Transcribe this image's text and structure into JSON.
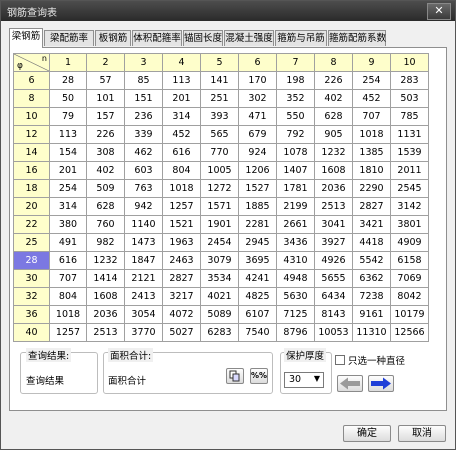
{
  "window": {
    "title": "钢筋查询表",
    "close_label": "✕"
  },
  "tabs": [
    "梁钢筋",
    "梁配筋率",
    "板钢筋",
    "体积配箍率",
    "锚固长度",
    "混凝土强度",
    "箍筋与吊筋",
    "箍筋配筋系数"
  ],
  "active_tab": 0,
  "table": {
    "corner": {
      "n": "n",
      "phi": "φ"
    },
    "columns": [
      "1",
      "2",
      "3",
      "4",
      "5",
      "6",
      "7",
      "8",
      "9",
      "10"
    ],
    "rows": [
      {
        "d": "6",
        "v": [
          "28",
          "57",
          "85",
          "113",
          "141",
          "170",
          "198",
          "226",
          "254",
          "283"
        ]
      },
      {
        "d": "8",
        "v": [
          "50",
          "101",
          "151",
          "201",
          "251",
          "302",
          "352",
          "402",
          "452",
          "503"
        ]
      },
      {
        "d": "10",
        "v": [
          "79",
          "157",
          "236",
          "314",
          "393",
          "471",
          "550",
          "628",
          "707",
          "785"
        ]
      },
      {
        "d": "12",
        "v": [
          "113",
          "226",
          "339",
          "452",
          "565",
          "679",
          "792",
          "905",
          "1018",
          "1131"
        ]
      },
      {
        "d": "14",
        "v": [
          "154",
          "308",
          "462",
          "616",
          "770",
          "924",
          "1078",
          "1232",
          "1385",
          "1539"
        ]
      },
      {
        "d": "16",
        "v": [
          "201",
          "402",
          "603",
          "804",
          "1005",
          "1206",
          "1407",
          "1608",
          "1810",
          "2011"
        ]
      },
      {
        "d": "18",
        "v": [
          "254",
          "509",
          "763",
          "1018",
          "1272",
          "1527",
          "1781",
          "2036",
          "2290",
          "2545"
        ]
      },
      {
        "d": "20",
        "v": [
          "314",
          "628",
          "942",
          "1257",
          "1571",
          "1885",
          "2199",
          "2513",
          "2827",
          "3142"
        ]
      },
      {
        "d": "22",
        "v": [
          "380",
          "760",
          "1140",
          "1521",
          "1901",
          "2281",
          "2661",
          "3041",
          "3421",
          "3801"
        ]
      },
      {
        "d": "25",
        "v": [
          "491",
          "982",
          "1473",
          "1963",
          "2454",
          "2945",
          "3436",
          "3927",
          "4418",
          "4909"
        ]
      },
      {
        "d": "28",
        "v": [
          "616",
          "1232",
          "1847",
          "2463",
          "3079",
          "3695",
          "4310",
          "4926",
          "5542",
          "6158"
        ]
      },
      {
        "d": "30",
        "v": [
          "707",
          "1414",
          "2121",
          "2827",
          "3534",
          "4241",
          "4948",
          "5655",
          "6362",
          "7069"
        ]
      },
      {
        "d": "32",
        "v": [
          "804",
          "1608",
          "2413",
          "3217",
          "4021",
          "4825",
          "5630",
          "6434",
          "7238",
          "8042"
        ]
      },
      {
        "d": "36",
        "v": [
          "1018",
          "2036",
          "3054",
          "4072",
          "5089",
          "6107",
          "7125",
          "8143",
          "9161",
          "10179"
        ]
      },
      {
        "d": "40",
        "v": [
          "1257",
          "2513",
          "3770",
          "5027",
          "6283",
          "7540",
          "8796",
          "10053",
          "11310",
          "12566"
        ]
      }
    ],
    "selected_row": 10
  },
  "query_result": {
    "label": "查询结果:",
    "value": "查询结果"
  },
  "area_total": {
    "label": "面积合计:",
    "value": "面积合计",
    "copy_icon": "copy-icon",
    "percent_label": "%%"
  },
  "cover": {
    "label": "保护厚度",
    "value": "30"
  },
  "single_diameter": {
    "label": "只选一种直径",
    "checked": false
  },
  "nav": {
    "prev_icon": "arrow-left-icon",
    "next_icon": "arrow-right-icon",
    "prev_color": "#9a9a9a",
    "next_color": "#1f3fd8"
  },
  "footer": {
    "ok_label": "确定",
    "cancel_label": "取消"
  },
  "colors": {
    "header_bg": "#fefecb",
    "selected_bg": "#7b78e2"
  }
}
